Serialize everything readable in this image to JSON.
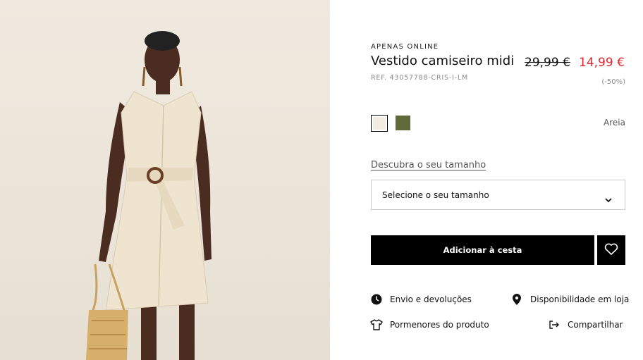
{
  "product": {
    "eyebrow": "APENAS ONLINE",
    "title": "Vestido camiseiro midi",
    "ref": "REF. 43057788-CRIS-I-LM",
    "old_price": "29,99 €",
    "new_price": "14,99 €",
    "discount": "(-50%)",
    "sale_color": "#e3262e"
  },
  "colors": {
    "selected_name": "Areia",
    "swatches": [
      {
        "name": "Areia",
        "hex": "#f2ece2",
        "selected": true
      },
      {
        "name": "olive",
        "hex": "#5f6b3b",
        "selected": false
      }
    ]
  },
  "size": {
    "discover_link": "Descubra o seu tamanho",
    "select_placeholder": "Selecione o seu tamanho"
  },
  "actions": {
    "add_to_cart": "Adicionar à cesta",
    "favorite_icon": "heart-icon"
  },
  "links": {
    "shipping": "Envio e devoluções",
    "availability": "Disponibilidade em loja",
    "details": "Pormenores do produto",
    "share": "Compartilhar"
  }
}
